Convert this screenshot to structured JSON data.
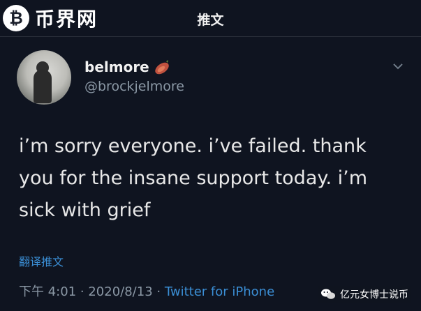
{
  "header": {
    "logo_text": "币界网",
    "logo_symbol": "₿",
    "title": "推文"
  },
  "tweet": {
    "display_name": "belmore",
    "handle": "@brockjelmore",
    "text_lines": [
      "i’m sorry everyone. i’ve failed. thank",
      "you for the insane support today. i’m",
      "sick with grief"
    ],
    "translate_label": "翻译推文",
    "time": "下午 4:01",
    "separator": "·",
    "date": "2020/8/13",
    "source": "Twitter for iPhone"
  },
  "watermark": {
    "text": "亿元女博士说币"
  },
  "colors": {
    "background": "#0f1420",
    "link_blue": "#3b8fd6",
    "muted": "#8b98a5"
  }
}
